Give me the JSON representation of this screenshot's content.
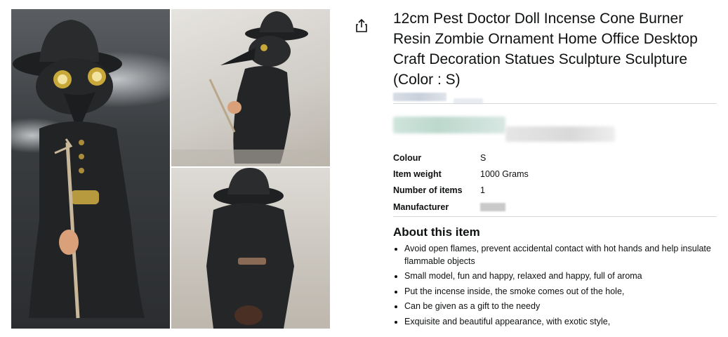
{
  "product": {
    "title": "12cm Pest Doctor Doll Incense Cone Burner Resin Zombie Ornament Home Office Desktop Craft Decoration Statues Sculpture Sculpture (Color : S)"
  },
  "specs": [
    {
      "label": "Colour",
      "value": "S"
    },
    {
      "label": "Item weight",
      "value": "1000 Grams"
    },
    {
      "label": "Number of items",
      "value": "1"
    },
    {
      "label": "Manufacturer",
      "value": ""
    }
  ],
  "about": {
    "heading": "About this item",
    "bullets": [
      "Avoid open flames, prevent accidental contact with hot hands and help insulate flammable objects",
      "Small model, fun and happy, relaxed and happy, full of aroma",
      "Put the incense inside, the smoke comes out of the hole,",
      "Can be given as a gift to the needy",
      "Exquisite and beautiful appearance, with exotic style,"
    ]
  },
  "icons": {
    "share": "share-icon"
  },
  "colors": {
    "text": "#0f1111",
    "divider": "#d5d9d9"
  }
}
